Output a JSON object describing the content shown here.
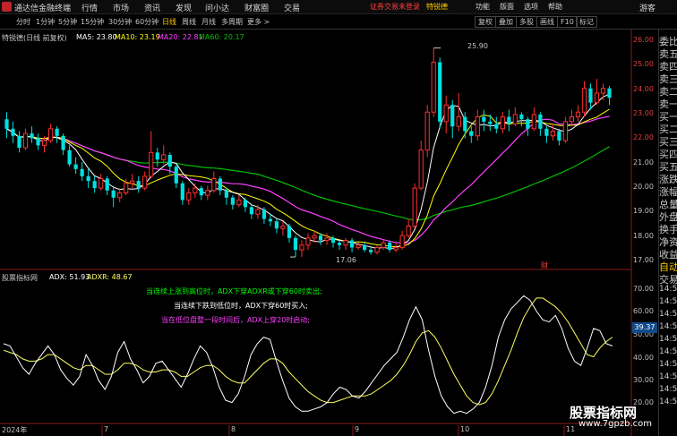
{
  "titlebar": {
    "app_title": "通达信金融终端",
    "menus": [
      "行情",
      "市场",
      "资讯",
      "发现",
      "问小达",
      "财富圈",
      "交易"
    ],
    "notice": "证券交易未登录",
    "notice_stock": "特锐德",
    "right_items": [
      "功能",
      "版面",
      "选项",
      "帮助"
    ],
    "guest": "游客"
  },
  "periods": [
    "分时",
    "1分钟",
    "5分钟",
    "15分钟",
    "30分钟",
    "60分钟",
    "日线",
    "周线",
    "月线",
    "多周期",
    "更多 >"
  ],
  "active_period": "日线",
  "toolbar_right": [
    "复权",
    "叠加",
    "多股",
    "画线",
    "F10",
    "标记"
  ],
  "main_legend": {
    "title": "特锐德(日线 前复权)",
    "ma5": "MA5: 23.80",
    "ma10": "MA10: 23.19",
    "ma20": "MA20: 22.81",
    "ma60": "MA60: 20.17"
  },
  "indicator_legend": {
    "title": "股票指标网",
    "adx": "ADX: 51.93",
    "adxr": "ADXR: 48.67"
  },
  "notes": [
    "当连续上涨到高位时，ADX下穿ADXR或下穿60时卖出;",
    "当连续下跌到低位时，ADX下穿60时买入;",
    "当在低位盘整一段时间后，ADX上穿20时启动;"
  ],
  "price_annotations": {
    "high": "25.90",
    "low": "17.06"
  },
  "price_axis": [
    "26.00",
    "25.00",
    "24.00",
    "23.00",
    "22.00",
    "21.00",
    "20.00",
    "19.00",
    "18.00",
    "17.00"
  ],
  "indicator_axis": [
    "70.00",
    "60.00",
    "50.00",
    "40.00",
    "30.00",
    "20.00"
  ],
  "current_indicator": "39.37",
  "x_axis": [
    "2024年",
    "7",
    "8",
    "9",
    "10",
    "11"
  ],
  "side_panel": [
    "委比",
    "卖五",
    "卖四",
    "卖三",
    "卖二",
    "卖一",
    "买一",
    "买二",
    "买三",
    "买四",
    "买五",
    "涨跌",
    "涨幅",
    "总量",
    "外盘",
    "换手",
    "净资",
    "收益",
    "自动",
    "交易",
    "14:56",
    "14:56",
    "14:56",
    "14:56",
    "14:56",
    "14:56",
    "14:56",
    "14:56",
    "14:56",
    "14:56"
  ],
  "fin_tag": "财",
  "watermark": {
    "title": "股票指标网",
    "url": "www.7gpzb.com"
  },
  "colors": {
    "up": "#ff3030",
    "down": "#00e0e0",
    "ma5": "#ffffff",
    "ma10": "#ffff00",
    "ma20": "#ff40ff",
    "ma60": "#00c000",
    "adx": "#ffffff",
    "adxr": "#ffff60"
  },
  "chart_data": {
    "type": "candlestick",
    "price_range": [
      16.8,
      26.3
    ],
    "indicator_range": [
      10,
      75
    ],
    "adx": [
      45,
      44,
      39,
      34,
      31,
      36,
      40,
      44,
      40,
      33,
      29,
      26,
      30,
      40,
      35,
      28,
      24,
      30,
      41,
      46,
      38,
      33,
      27,
      30,
      36,
      37,
      33,
      29,
      25,
      31,
      38,
      44,
      41,
      34,
      25,
      19,
      18,
      22,
      30,
      40,
      45,
      48,
      47,
      37,
      28,
      20,
      16,
      14,
      14,
      15,
      16,
      18,
      22,
      25,
      24,
      21,
      20,
      23,
      27,
      31,
      35,
      38,
      41,
      48,
      56,
      62,
      56,
      42,
      30,
      21,
      16,
      13,
      14,
      13,
      15,
      18,
      25,
      35,
      48,
      56,
      61,
      64,
      67,
      65,
      60,
      56,
      55,
      58,
      52,
      43,
      37,
      35,
      43,
      52,
      51,
      45,
      44
    ],
    "adxr": [
      42,
      41,
      40,
      38,
      37,
      37,
      38,
      40,
      40,
      38,
      36,
      34,
      33,
      35,
      35,
      33,
      31,
      31,
      33,
      36,
      36,
      35,
      33,
      32,
      32,
      33,
      33,
      32,
      30,
      30,
      32,
      34,
      35,
      35,
      33,
      30,
      28,
      27,
      27,
      30,
      33,
      36,
      38,
      38,
      36,
      32,
      29,
      26,
      23,
      21,
      19,
      18,
      18,
      19,
      20,
      21,
      21,
      21,
      22,
      24,
      26,
      28,
      31,
      35,
      40,
      46,
      50,
      51,
      48,
      43,
      37,
      31,
      26,
      21,
      18,
      17,
      18,
      22,
      28,
      35,
      42,
      50,
      57,
      62,
      66,
      66,
      64,
      62,
      59,
      55,
      50,
      45,
      40,
      39,
      43,
      46,
      48
    ],
    "candles": [
      [
        22.9,
        22.5,
        23.2,
        22.1
      ],
      [
        22.5,
        22.2,
        22.8,
        21.9
      ],
      [
        22.2,
        21.7,
        22.4,
        21.5
      ],
      [
        21.7,
        22.3,
        22.5,
        21.6
      ],
      [
        22.3,
        22.1,
        22.6,
        21.9
      ],
      [
        22.1,
        21.8,
        22.3,
        21.6
      ],
      [
        21.8,
        22.0,
        22.2,
        21.5
      ],
      [
        22.0,
        22.5,
        22.7,
        21.9
      ],
      [
        22.5,
        22.2,
        22.6,
        21.9
      ],
      [
        22.2,
        21.6,
        22.3,
        21.4
      ],
      [
        21.6,
        21.0,
        21.8,
        20.9
      ],
      [
        21.0,
        20.8,
        21.3,
        20.6
      ],
      [
        20.8,
        20.5,
        21.1,
        20.3
      ],
      [
        20.5,
        20.3,
        20.8,
        20.0
      ],
      [
        20.3,
        20.0,
        20.5,
        19.8
      ],
      [
        20.0,
        20.4,
        20.6,
        19.9
      ],
      [
        20.4,
        19.9,
        20.5,
        19.7
      ],
      [
        19.9,
        19.6,
        20.1,
        19.2
      ],
      [
        19.6,
        19.8,
        20.0,
        19.4
      ],
      [
        19.8,
        20.2,
        20.4,
        19.7
      ],
      [
        20.2,
        20.3,
        20.6,
        20.0
      ],
      [
        20.3,
        20.0,
        20.5,
        19.8
      ],
      [
        20.0,
        20.5,
        20.7,
        19.9
      ],
      [
        20.5,
        21.5,
        22.4,
        20.4
      ],
      [
        21.5,
        21.2,
        21.7,
        20.9
      ],
      [
        21.2,
        21.4,
        21.8,
        21.0
      ],
      [
        21.4,
        20.9,
        21.5,
        20.6
      ],
      [
        20.9,
        20.2,
        21.0,
        20.0
      ],
      [
        20.2,
        19.5,
        20.3,
        19.3
      ],
      [
        19.5,
        19.8,
        20.0,
        19.3
      ],
      [
        19.8,
        20.0,
        20.2,
        19.6
      ],
      [
        20.0,
        19.7,
        20.1,
        19.5
      ],
      [
        19.7,
        19.9,
        20.1,
        19.5
      ],
      [
        19.9,
        20.4,
        20.7,
        19.8
      ],
      [
        20.4,
        19.9,
        20.5,
        19.7
      ],
      [
        19.9,
        19.6,
        20.0,
        19.3
      ],
      [
        19.6,
        19.3,
        19.7,
        19.1
      ],
      [
        19.3,
        19.5,
        19.7,
        19.2
      ],
      [
        19.5,
        19.2,
        19.6,
        19.0
      ],
      [
        19.2,
        18.9,
        19.3,
        18.7
      ],
      [
        18.9,
        19.1,
        19.3,
        18.7
      ],
      [
        19.1,
        18.7,
        19.2,
        18.5
      ],
      [
        18.7,
        18.6,
        18.9,
        18.4
      ],
      [
        18.6,
        18.3,
        18.7,
        18.1
      ],
      [
        18.3,
        18.4,
        18.6,
        18.0
      ],
      [
        18.4,
        17.9,
        18.5,
        17.7
      ],
      [
        17.9,
        17.4,
        18.0,
        17.1
      ],
      [
        17.4,
        17.6,
        17.8,
        17.1
      ],
      [
        17.6,
        17.9,
        18.1,
        17.4
      ],
      [
        17.9,
        18.0,
        18.2,
        17.7
      ],
      [
        18.0,
        17.8,
        18.1,
        17.6
      ],
      [
        17.8,
        17.9,
        18.1,
        17.6
      ],
      [
        17.9,
        17.7,
        18.0,
        17.5
      ],
      [
        17.7,
        17.6,
        17.8,
        17.4
      ],
      [
        17.6,
        17.8,
        17.9,
        17.4
      ],
      [
        17.8,
        17.5,
        17.9,
        17.3
      ],
      [
        17.5,
        17.6,
        17.7,
        17.4
      ],
      [
        17.6,
        17.4,
        17.7,
        17.3
      ],
      [
        17.4,
        17.3,
        17.5,
        17.2
      ],
      [
        17.3,
        17.5,
        17.6,
        17.2
      ],
      [
        17.5,
        17.7,
        17.8,
        17.4
      ],
      [
        17.7,
        17.4,
        17.8,
        17.3
      ],
      [
        17.4,
        17.5,
        17.7,
        17.3
      ],
      [
        17.5,
        18.0,
        18.2,
        17.4
      ],
      [
        18.0,
        18.4,
        18.7,
        17.9
      ],
      [
        18.4,
        20.0,
        20.2,
        18.3
      ],
      [
        20.0,
        21.6,
        22.0,
        19.9
      ],
      [
        21.6,
        23.2,
        23.5,
        21.3
      ],
      [
        23.2,
        25.3,
        25.9,
        23.0
      ],
      [
        25.3,
        22.8,
        25.5,
        22.5
      ],
      [
        22.8,
        23.5,
        23.9,
        22.3
      ],
      [
        23.5,
        22.6,
        23.7,
        22.1
      ],
      [
        22.6,
        23.0,
        24.0,
        22.4
      ],
      [
        23.0,
        22.4,
        23.2,
        22.1
      ],
      [
        22.4,
        22.2,
        22.6,
        21.9
      ],
      [
        22.2,
        23.0,
        23.3,
        22.0
      ],
      [
        23.0,
        22.8,
        23.3,
        22.4
      ],
      [
        22.8,
        22.7,
        23.1,
        22.4
      ],
      [
        22.7,
        22.5,
        23.0,
        22.3
      ],
      [
        22.5,
        23.0,
        23.2,
        22.3
      ],
      [
        23.0,
        22.7,
        23.3,
        22.4
      ],
      [
        22.7,
        23.1,
        23.4,
        22.6
      ],
      [
        23.1,
        22.9,
        23.2,
        22.6
      ],
      [
        22.9,
        22.5,
        23.0,
        22.2
      ],
      [
        22.5,
        23.1,
        23.4,
        22.4
      ],
      [
        23.1,
        22.5,
        23.2,
        22.2
      ],
      [
        22.5,
        22.2,
        22.6,
        21.9
      ],
      [
        22.2,
        22.4,
        22.7,
        22.0
      ],
      [
        22.4,
        22.0,
        22.5,
        21.8
      ],
      [
        22.0,
        22.8,
        23.0,
        21.9
      ],
      [
        22.8,
        23.0,
        23.3,
        22.6
      ],
      [
        23.0,
        23.2,
        23.5,
        22.8
      ],
      [
        23.2,
        24.2,
        24.5,
        23.0
      ],
      [
        24.2,
        23.6,
        24.4,
        23.3
      ],
      [
        23.6,
        24.0,
        24.6,
        23.5
      ],
      [
        24.0,
        24.2,
        24.4,
        23.7
      ],
      [
        24.2,
        23.8,
        24.3,
        23.5
      ]
    ]
  }
}
